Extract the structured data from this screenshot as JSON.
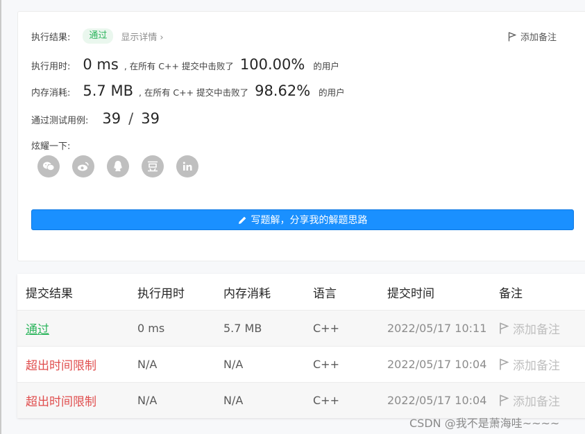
{
  "result": {
    "label": "执行结果:",
    "status": "通过",
    "detail_link": "显示详情",
    "detail_chevron": "›",
    "add_note": "添加备注"
  },
  "runtime": {
    "label": "执行用时:",
    "value": "0 ms",
    "phrase": ", 在所有 C++ 提交中击败了",
    "percent": "100.00%",
    "suffix": "的用户"
  },
  "memory": {
    "label": "内存消耗:",
    "value": "5.7 MB",
    "phrase": ", 在所有 C++ 提交中击败了",
    "percent": "98.62%",
    "suffix": "的用户"
  },
  "tests": {
    "label": "通过测试用例:",
    "passed": "39",
    "separator": "/",
    "total": "39"
  },
  "share": {
    "label": "炫耀一下:",
    "icons": [
      {
        "name": "wechat-icon",
        "glyph": "✱"
      },
      {
        "name": "weibo-icon",
        "glyph": "◉"
      },
      {
        "name": "qq-icon",
        "glyph": "♟"
      },
      {
        "name": "douban-icon",
        "glyph": "豆"
      },
      {
        "name": "linkedin-icon",
        "glyph": "in"
      }
    ]
  },
  "solution_button": "写题解，分享我的解题思路",
  "table": {
    "headers": [
      "提交结果",
      "执行用时",
      "内存消耗",
      "语言",
      "提交时间",
      "备注"
    ],
    "rows": [
      {
        "status": "通过",
        "type": "pass",
        "time": "0 ms",
        "memory": "5.7 MB",
        "lang": "C++",
        "submitted": "2022/05/17 10:11",
        "note": "添加备注"
      },
      {
        "status": "超出时间限制",
        "type": "fail",
        "time": "N/A",
        "memory": "N/A",
        "lang": "C++",
        "submitted": "2022/05/17 10:04",
        "note": "添加备注"
      },
      {
        "status": "超出时间限制",
        "type": "fail",
        "time": "N/A",
        "memory": "N/A",
        "lang": "C++",
        "submitted": "2022/05/17 10:04",
        "note": "添加备注"
      }
    ]
  },
  "watermark": "CSDN @我不是萧海哇~~~~",
  "colors": {
    "accent": "#1a90ff",
    "success": "#2db55d",
    "error": "#e04e4e"
  }
}
